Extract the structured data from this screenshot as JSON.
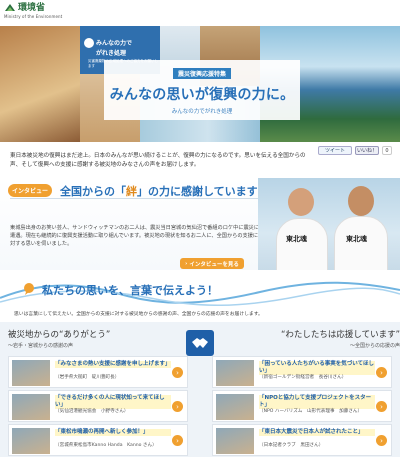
{
  "header": {
    "logo_text": "環境省",
    "logo_sub": "Ministry of the Environment"
  },
  "hero": {
    "banner_line1": "みんなの力で",
    "banner_line2": "がれき処理",
    "banner_line3": "災害廃棄物の広域処理へのご協力をお願いします",
    "special_label": "震災復興応援特集",
    "main_title": "みんなの思いが復興の力に。",
    "sub_title": "みんなの力でがれき処理"
  },
  "intro": {
    "text": "東日本被災地の復興はまだ途上。日本のみんなが思い続けることが、復興の力になるのです。思いを伝える全国からの声、そして復興への支援に感謝する被災地のみなさんの声をお届けします。"
  },
  "share": {
    "tweet": "ツイート",
    "like": "いいね！",
    "like_count": "0"
  },
  "interview": {
    "tab": "インタビュー",
    "title_pre": "全国からの「",
    "title_kizuna": "絆",
    "title_post": "」の力に感謝しています！",
    "text": "東城島出身のお笑い芸人、サンドウィッチマンのお二人は、震災当日宮城の気仙沼で番組のロケ中に震災に遭遇。現在も継続的に復興支援活動に取り組んでいます。被災地の現状を知るお二人に、全国からの支援に対する思いを伺いました。",
    "shirt1": "東北魂",
    "shirt2": "東北魂",
    "more_button": "インタビューを見る"
  },
  "words": {
    "title": "私たちの思いを、言葉で伝えよう！",
    "text": "思いは言葉にして伝えたい。全国からの支援に対する被災地からの感謝の声、全国からの応援の声をお届けします。"
  },
  "left_column": {
    "heading": "被災地からの“ありがとう”",
    "subheading": "〜岩手・宮城からの感謝の声",
    "items": [
      {
        "title": "「みなさまの熱い支援に感謝を申し上げます」",
        "sub": "（岩手県大槌町　碇川豊町長）"
      },
      {
        "title": "「できるだけ多くの人に現状知って来てほしい」",
        "sub": "（気仙沼港観光協会　小野寺さん）"
      },
      {
        "title": "「東松市鳴瀬の再開へ新しく参加！」",
        "sub": "（宮城県東松島市Kanno Handa　Kanno さん）"
      }
    ]
  },
  "right_column": {
    "heading": "“わたしたちは応援しています”",
    "subheading": "〜全国からの応援の声",
    "items": [
      {
        "title": "「困っている人たちがいる事実を気づいてほしい」",
        "sub": "（新宿ゴールデン街経営者　長谷川さん）"
      },
      {
        "title": "「NPOと協力して支援プロジェクトをスタート」",
        "sub": "（NPO ハーバリズム　山形代表理事　加藤さん）"
      },
      {
        "title": "「東日本大震災で日本人が試されたこと」",
        "sub": "（日本記者クラブ　黒田さん）"
      }
    ]
  }
}
